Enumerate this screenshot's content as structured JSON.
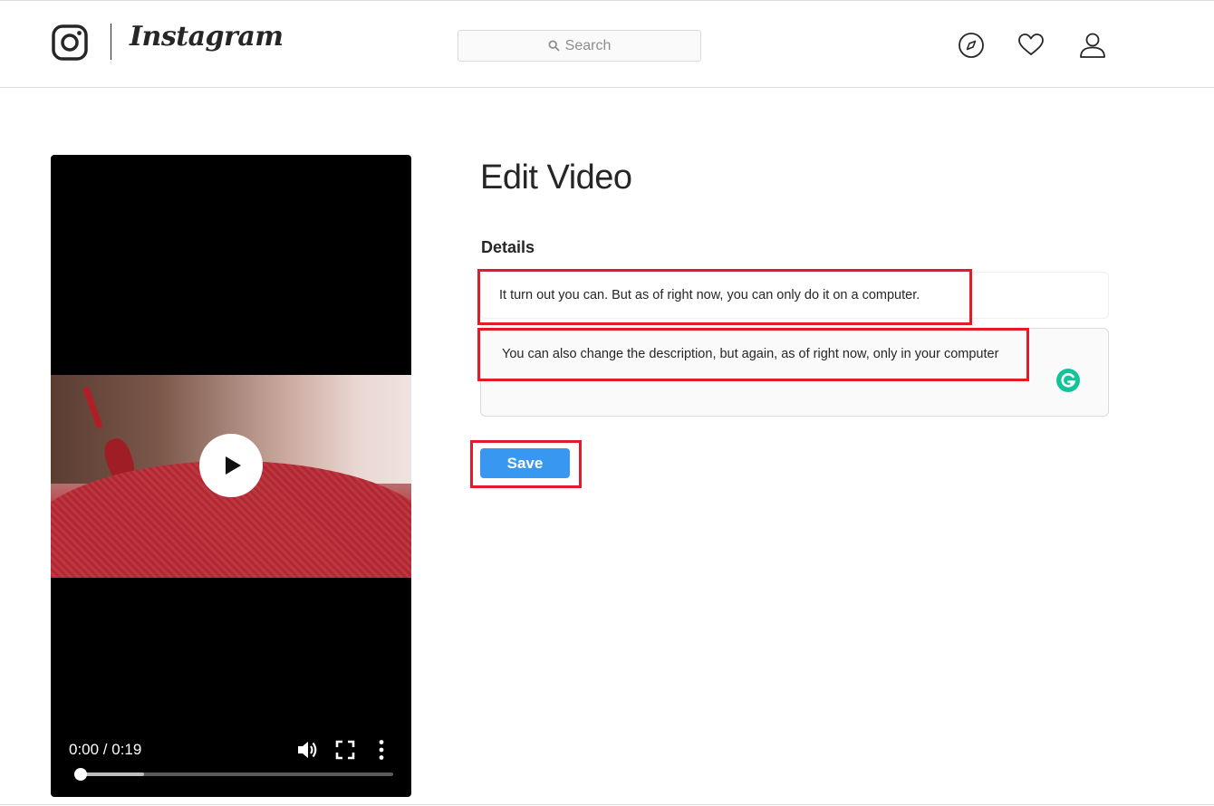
{
  "header": {
    "logo_text": "Instagram",
    "search_placeholder": "Search",
    "icons": [
      "instagram-glyph-icon",
      "search-icon",
      "explore-compass-icon",
      "activity-heart-icon",
      "profile-icon"
    ]
  },
  "video": {
    "time_display": "0:00 / 0:19",
    "played_fraction": 0.0,
    "buffered_fraction": 0.22,
    "icons": [
      "play-icon",
      "volume-icon",
      "fullscreen-icon",
      "more-options-icon"
    ]
  },
  "editor": {
    "title": "Edit Video",
    "details_label": "Details",
    "title_field_value": "It turn out you can. But as of right now, you can only do it on a computer.",
    "description_field_value": "You can also change the description, but again, as of right now, only in your computer",
    "save_label": "Save",
    "grammarly_icon": "grammarly-icon"
  },
  "colors": {
    "accent_blue": "#3897f0",
    "highlight_red": "#e21b2b",
    "grammarly_green": "#15c39a",
    "border_gray": "#dbdbdb"
  }
}
